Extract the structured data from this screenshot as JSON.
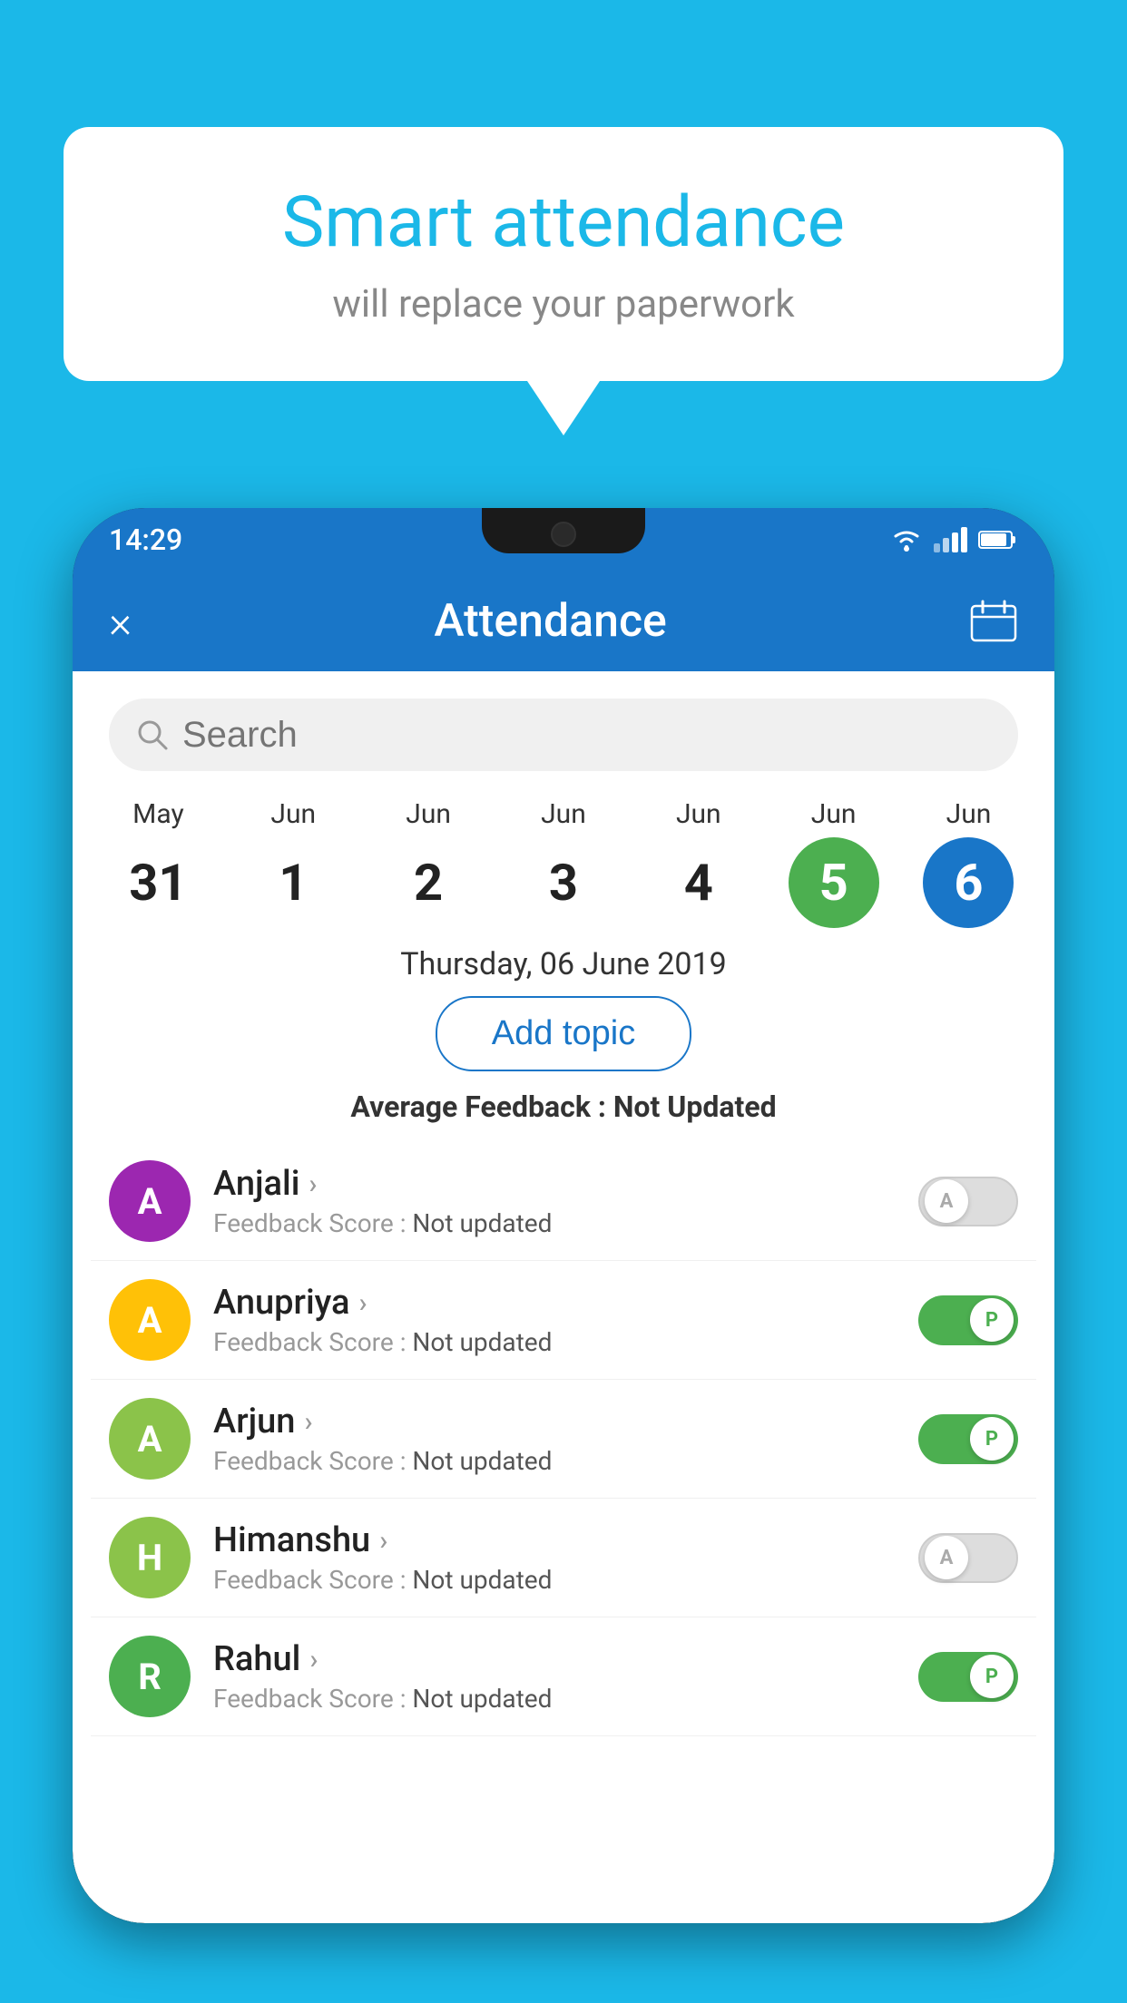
{
  "background_color": "#1BB8E8",
  "speech_bubble": {
    "title": "Smart attendance",
    "subtitle": "will replace your paperwork"
  },
  "status_bar": {
    "time": "14:29"
  },
  "app_bar": {
    "title": "Attendance",
    "close_label": "×",
    "calendar_label": "📅"
  },
  "search": {
    "placeholder": "Search"
  },
  "calendar": {
    "days": [
      {
        "month": "May",
        "date": "31",
        "style": "normal"
      },
      {
        "month": "Jun",
        "date": "1",
        "style": "normal"
      },
      {
        "month": "Jun",
        "date": "2",
        "style": "normal"
      },
      {
        "month": "Jun",
        "date": "3",
        "style": "normal"
      },
      {
        "month": "Jun",
        "date": "4",
        "style": "normal"
      },
      {
        "month": "Jun",
        "date": "5",
        "style": "today"
      },
      {
        "month": "Jun",
        "date": "6",
        "style": "selected"
      }
    ]
  },
  "selected_date": "Thursday, 06 June 2019",
  "add_topic_label": "Add topic",
  "avg_feedback": {
    "label": "Average Feedback :",
    "value": "Not Updated"
  },
  "students": [
    {
      "name": "Anjali",
      "avatar_letter": "A",
      "avatar_color": "#9C27B0",
      "feedback_label": "Feedback Score :",
      "feedback_value": "Not updated",
      "toggle": "off",
      "toggle_letter": "A"
    },
    {
      "name": "Anupriya",
      "avatar_letter": "A",
      "avatar_color": "#FFC107",
      "feedback_label": "Feedback Score :",
      "feedback_value": "Not updated",
      "toggle": "on",
      "toggle_letter": "P"
    },
    {
      "name": "Arjun",
      "avatar_letter": "A",
      "avatar_color": "#8BC34A",
      "feedback_label": "Feedback Score :",
      "feedback_value": "Not updated",
      "toggle": "on",
      "toggle_letter": "P"
    },
    {
      "name": "Himanshu",
      "avatar_letter": "H",
      "avatar_color": "#8BC34A",
      "feedback_label": "Feedback Score :",
      "feedback_value": "Not updated",
      "toggle": "off",
      "toggle_letter": "A"
    },
    {
      "name": "Rahul",
      "avatar_letter": "R",
      "avatar_color": "#4CAF50",
      "feedback_label": "Feedback Score :",
      "feedback_value": "Not updated",
      "toggle": "on",
      "toggle_letter": "P"
    }
  ]
}
